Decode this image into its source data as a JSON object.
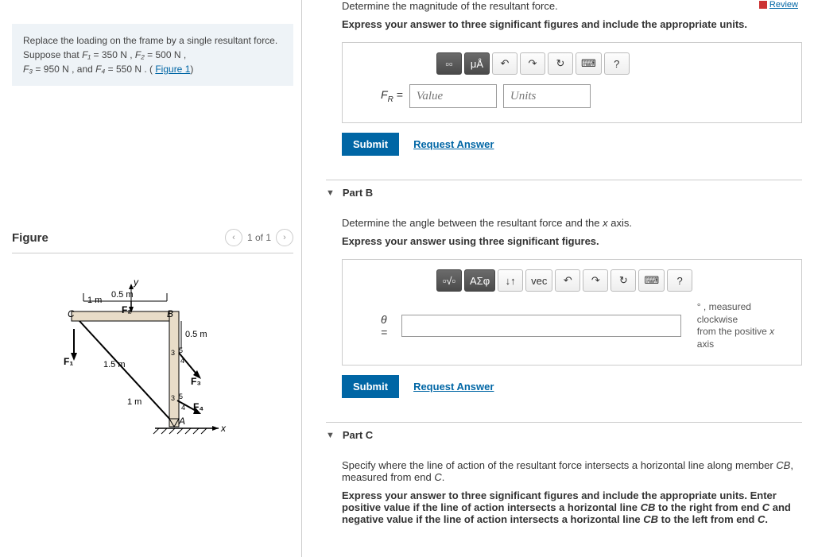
{
  "review": "Review",
  "problem": {
    "text_prefix": "Replace the loading on the frame by a single resultant force. Suppose that ",
    "f1_label": "F₁",
    "f1_val": " = 350  N ,",
    "f2_label": "F₂",
    "f2_val": " = 500  N ,",
    "f3_label": "F₃",
    "f3_val": " = 950  N , and ",
    "f4_label": "F₄",
    "f4_val": " = 550  N . (",
    "figure_link": "Figure 1",
    "close": ")"
  },
  "figure": {
    "title": "Figure",
    "nav": "1 of 1"
  },
  "partA": {
    "question": "Determine the magnitude of the resultant force.",
    "instruction": "Express your answer to three significant figures and include the appropriate units.",
    "var": "F",
    "sub": "R",
    "eq": " =",
    "value_ph": "Value",
    "units_ph": "Units",
    "submit": "Submit",
    "request": "Request Answer",
    "tool_mu": "μÅ",
    "tool_q": "?"
  },
  "partB": {
    "title": "Part B",
    "question": "Determine the angle between the resultant force and the x axis.",
    "instruction": "Express your answer using three significant figures.",
    "var": "θ =",
    "hint": "° , measured clockwise from the positive x axis",
    "submit": "Submit",
    "request": "Request Answer",
    "tool_greek": "ΑΣφ",
    "tool_vec": "vec",
    "tool_q": "?"
  },
  "partC": {
    "title": "Part C",
    "question": "Specify where the line of action of the resultant force intersects a horizontal line along member CB, measured from end C.",
    "instruction": "Express your answer to three significant figures and include the appropriate units. Enter positive value if the line of action intersects a horizontal line CB to the right from end C and negative value if the line of action intersects a horizontal line CB to the left from end C."
  }
}
